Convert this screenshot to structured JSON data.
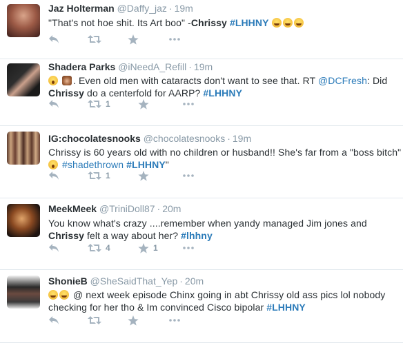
{
  "tweets": [
    {
      "fullname": "Jaz Holterman",
      "handle": "@Daffy_jaz",
      "time": "19m",
      "text1": "\"That's not hoe shit. Its Art boo\" -",
      "bold1": "Chrissy",
      "tag": "#LHHNY",
      "emoji": [
        "laugh",
        "laugh",
        "laugh"
      ],
      "retweets": "",
      "favorites": ""
    },
    {
      "fullname": "Shadera Parks",
      "handle": "@iNeedA_Refill",
      "time": "19m",
      "emoji": [
        "shock",
        "monkey"
      ],
      "text1": ". Even old men with cataracts don't want to see that.  RT ",
      "mention": "@DCFresh",
      "text2": ": Did",
      "bold1": "Chrissy",
      "text3": " do a centerfold for AARP? ",
      "tag": "#LHHNY",
      "retweets": "1",
      "favorites": ""
    },
    {
      "fullname": "IG:chocolatesnooks",
      "handle": "@chocolatesnooks",
      "time": "19m",
      "text1": "Chrissy is 60 years old with no children or husband!! She's far from a \"boss bitch\" ",
      "emoji": [
        "shock"
      ],
      "tag1": "#shadethrown",
      "tag2": "#LHHNY",
      "end": "\"",
      "retweets": "1",
      "favorites": ""
    },
    {
      "fullname": "MeekMeek",
      "handle": "@TriniDoll87",
      "time": "20m",
      "text1": "You know what's crazy ....remember when yandy managed Jim jones and",
      "bold1": "Chrissy",
      "text2": " felt a way about her? ",
      "tag": "#lhhny",
      "retweets": "4",
      "favorites": "1"
    },
    {
      "fullname": "ShonieB",
      "handle": "@SheSaidThat_Yep",
      "time": "20m",
      "emoji": [
        "laugh",
        "laugh"
      ],
      "text1": " @ next week episode Chinx going in abt Chrissy old ass pics lol nobody checking for her tho & Im convinced Cisco bipolar ",
      "tag": "#LHHNY",
      "retweets": "",
      "favorites": ""
    }
  ]
}
